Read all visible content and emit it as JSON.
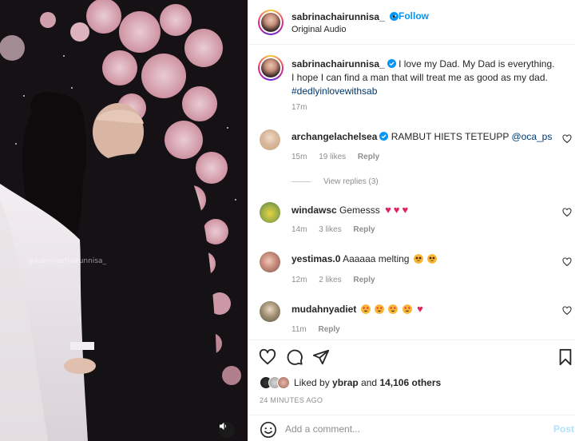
{
  "media": {
    "watermark": "@sabrinachairunnisa_",
    "audio_icon": "speaker-icon"
  },
  "header": {
    "username": "sabrinachairunnisa_",
    "follow_label": "Follow",
    "subtitle": "Original Audio",
    "dot": "•"
  },
  "caption": {
    "username": "sabrinachairunnisa_",
    "text": "I love my Dad. My Dad is everything. I hope I can find a man that will treat me as good as my dad.",
    "hashtag": "#dedlyinlovewithsab",
    "time": "17m"
  },
  "comments": [
    {
      "username": "archangelachelsea",
      "text": "RAMBUT HIETS TETEUPP",
      "mention": "@oca_ps",
      "time": "15m",
      "likes": "19 likes",
      "reply": "Reply",
      "view_replies": "View replies (3)"
    },
    {
      "username": "windawsc",
      "text": "Gemesss",
      "time": "14m",
      "likes": "3 likes",
      "reply": "Reply"
    },
    {
      "username": "yestimas.0",
      "text": "Aaaaaa melting",
      "time": "12m",
      "likes": "2 likes",
      "reply": "Reply"
    },
    {
      "username": "mudahnyadiet",
      "text": "",
      "time": "11m",
      "reply": "Reply"
    }
  ],
  "likes": {
    "prefix": "Liked by",
    "user": "ybrap",
    "conj": "and",
    "count": "14,106 others"
  },
  "post_time": "24 MINUTES AGO",
  "add_comment": {
    "placeholder": "Add a comment...",
    "post_label": "Post"
  },
  "colors": {
    "accent": "#0095f6",
    "heart": "#e0245e",
    "muted": "#8e8e8e"
  }
}
